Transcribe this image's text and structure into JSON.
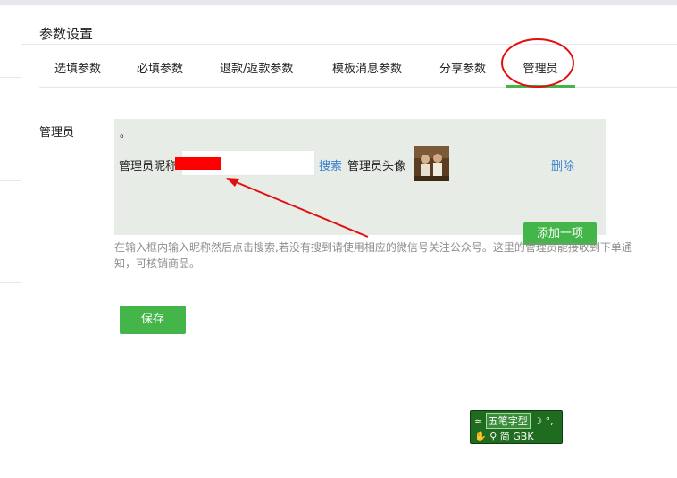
{
  "page": {
    "title": "参数设置"
  },
  "tabs": [
    {
      "label": "选填参数"
    },
    {
      "label": "必填参数"
    },
    {
      "label": "退款/返款参数"
    },
    {
      "label": "模板消息参数"
    },
    {
      "label": "分享参数"
    },
    {
      "label": "管理员",
      "active": true
    }
  ],
  "admin": {
    "field_label": "管理员",
    "dot": "。",
    "nickname_label": "管理员昵称",
    "nickname_value": "",
    "search_label": "搜索",
    "avatar_label": "管理员头像",
    "delete_label": "删除",
    "add_label": "添加一项",
    "help_text": "在输入框内输入昵称然后点击搜索,若没有搜到请使用相应的微信号关注公众号。这里的管理员能接收到下单通知，可核销商品。"
  },
  "actions": {
    "save_label": "保存"
  },
  "ime": {
    "mode_label": "五笔字型",
    "lang_label": "简",
    "encoding_label": "GBK",
    "moon_glyph": "☽",
    "punct_glyph": "°,",
    "hand_glyph": "✋",
    "search_glyph": "⚲",
    "expand_glyph": "≈"
  },
  "colors": {
    "accent": "#44b549",
    "link": "#3a7fd0",
    "annotation": "#e01010",
    "panel_bg": "#e8ece6"
  }
}
